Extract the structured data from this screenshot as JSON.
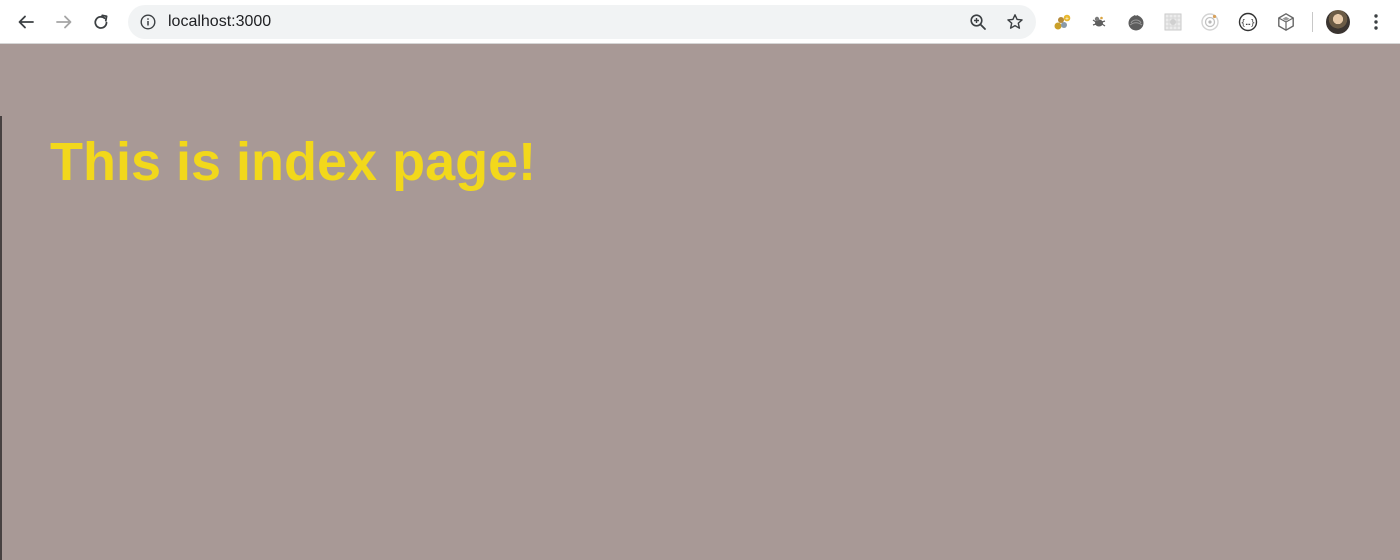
{
  "browser": {
    "url": "localhost:3000",
    "extensions": [
      "badge-extension-icon",
      "spider-extension-icon",
      "tomato-extension-icon",
      "grid-extension-icon",
      "target-extension-icon",
      "code-extension-icon",
      "cube-extension-icon"
    ]
  },
  "page": {
    "heading": "This is index page!",
    "colors": {
      "background": "#a89996",
      "heading": "#f2d81b"
    }
  }
}
